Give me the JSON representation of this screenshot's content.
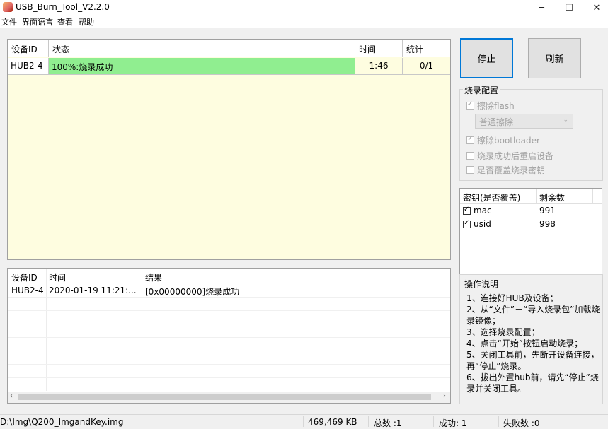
{
  "window": {
    "title": "USB_Burn_Tool_V2.2.0",
    "minimize": "─",
    "maximize": "☐",
    "close": "✕"
  },
  "menu": [
    "文件",
    "界面语言",
    "查看",
    "帮助"
  ],
  "device_table": {
    "headers": [
      "设备ID",
      "状态",
      "时间",
      "统计"
    ],
    "rows": [
      {
        "device_id": "HUB2-4",
        "status": "100%:烧录成功",
        "time": "1:46",
        "stats": "0/1",
        "progress": 1.0
      }
    ]
  },
  "buttons": {
    "stop": "停止",
    "refresh": "刷新"
  },
  "burn_config": {
    "title": "烧录配置",
    "erase_flash": {
      "label": "擦除flash",
      "checked": true,
      "enabled": false
    },
    "erase_mode": "普通擦除",
    "erase_bootloader": {
      "label": "擦除bootloader",
      "checked": true,
      "enabled": false
    },
    "restart_after": {
      "label": "烧录成功后重启设备",
      "checked": false,
      "enabled": false
    },
    "overwrite_key": {
      "label": "是否覆盖烧录密钥",
      "checked": false,
      "enabled": false
    }
  },
  "key_table": {
    "headers": [
      "密钥(是否覆盖)",
      "剩余数"
    ],
    "rows": [
      {
        "name": "mac",
        "checked": true,
        "remaining": "991"
      },
      {
        "name": "usid",
        "checked": true,
        "remaining": "998"
      }
    ]
  },
  "log_table": {
    "headers": [
      "设备ID",
      "时间",
      "结果"
    ],
    "rows": [
      {
        "device_id": "HUB2-4",
        "time": "2020-01-19 11:21:...",
        "result": "[0x00000000]烧录成功"
      }
    ]
  },
  "instructions": {
    "title": "操作说明",
    "lines": [
      "1、连接好HUB及设备；",
      "2、从“文件”－“导入烧录包”加载烧录镜像；",
      "3、选择烧录配置；",
      "4、点击“开始”按钮启动烧录；",
      "5、关闭工具前，先断开设备连接，再“停止”烧录。",
      "6、拔出外置hub前，请先“停止”烧录并关闭工具。"
    ]
  },
  "status_bar": {
    "path": "D:\\Img\\Q200_ImgandKey.img",
    "size": "469,469 KB",
    "total": "总数 :1",
    "success": "成功:  1",
    "failed": "失败数 :0"
  },
  "colors": {
    "progress_fill": "#90ee90",
    "grid_background": "#fefde0",
    "primary_border": "#0078d7"
  }
}
